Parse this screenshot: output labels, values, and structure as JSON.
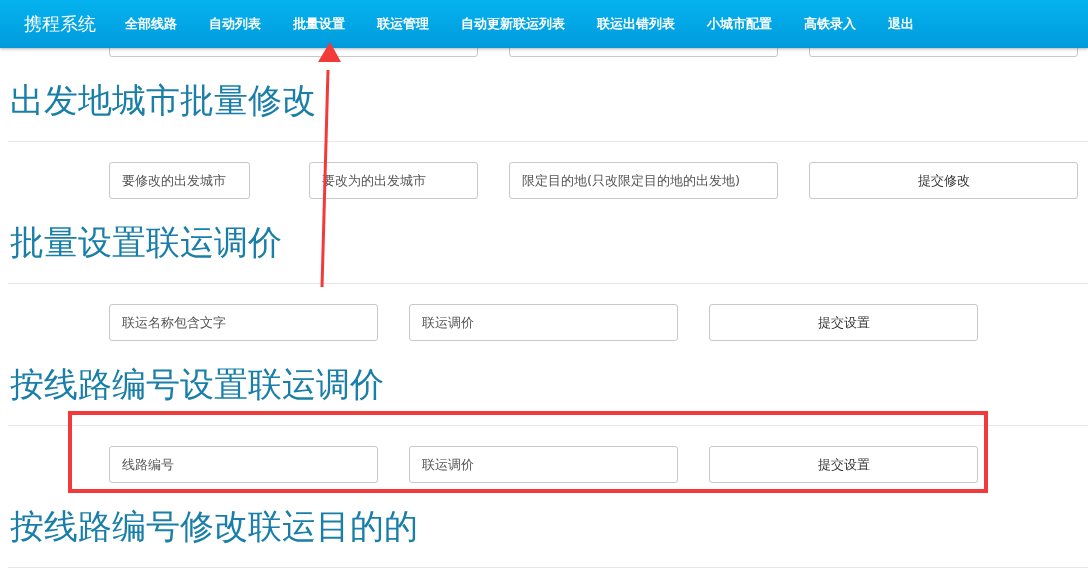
{
  "navbar": {
    "brand": "携程系统",
    "items": [
      "全部线路",
      "自动列表",
      "批量设置",
      "联运管理",
      "自动更新联运列表",
      "联运出错列表",
      "小城市配置",
      "高铁录入",
      "退出"
    ]
  },
  "sections": [
    {
      "title": "出发地城市批量修改",
      "controls": [
        {
          "kind": "field",
          "placeholder": "要修改的出发城市"
        },
        {
          "kind": "field",
          "placeholder": "要改为的出发城市"
        },
        {
          "kind": "field",
          "placeholder": "限定目的地(只改限定目的地的出发地)"
        },
        {
          "kind": "button",
          "label": "提交修改"
        }
      ]
    },
    {
      "title": "批量设置联运调价",
      "controls": [
        {
          "kind": "field",
          "placeholder": "联运名称包含文字"
        },
        {
          "kind": "field",
          "placeholder": "联运调价"
        },
        {
          "kind": "button",
          "label": "提交设置"
        }
      ]
    },
    {
      "title": "按线路编号设置联运调价",
      "controls": [
        {
          "kind": "field",
          "placeholder": "线路编号"
        },
        {
          "kind": "field",
          "placeholder": "联运调价"
        },
        {
          "kind": "button",
          "label": "提交设置"
        }
      ]
    },
    {
      "title": "按线路编号修改联运目的的"
    }
  ]
}
